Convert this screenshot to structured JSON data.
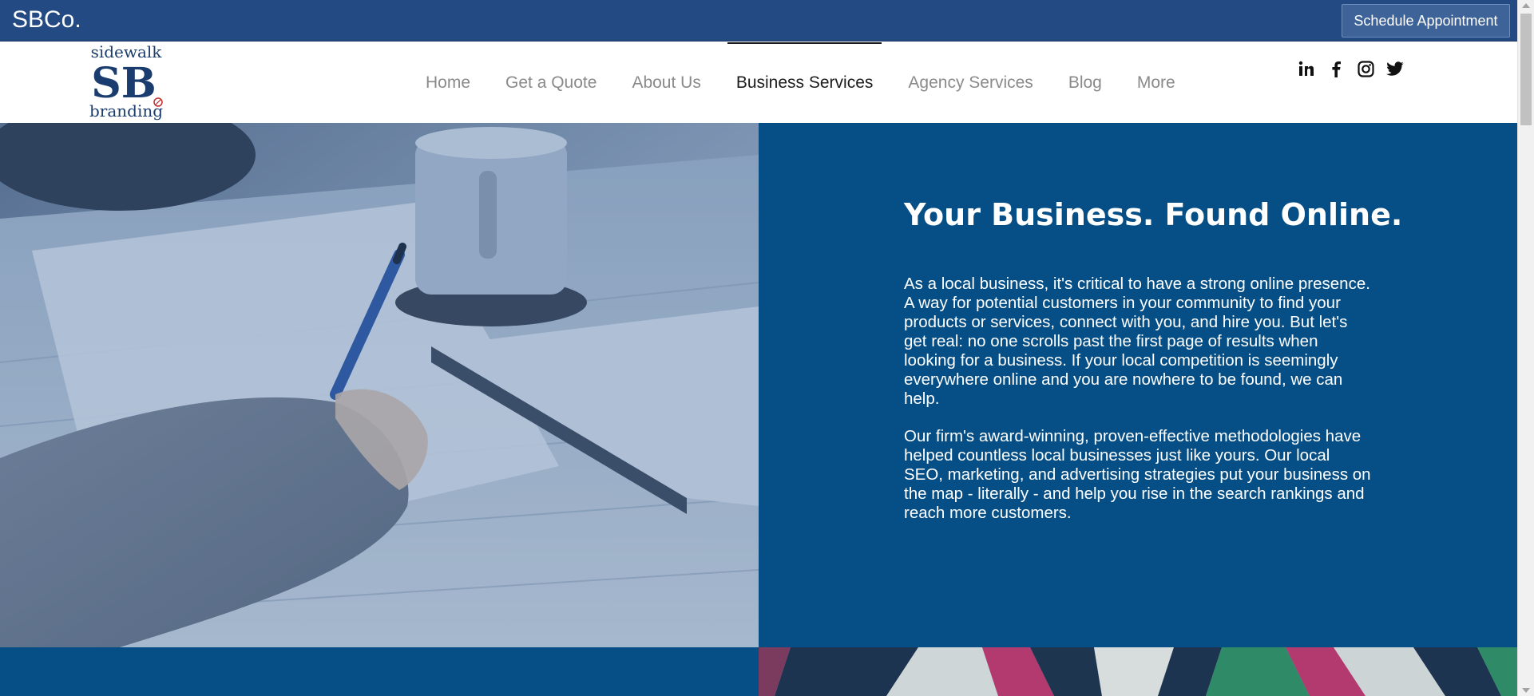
{
  "topbar": {
    "brand": "SBCo.",
    "schedule_label": "Schedule Appointment"
  },
  "logo": {
    "line1": "sidewalk",
    "initials": "SB",
    "line2": "branding"
  },
  "nav": {
    "items": [
      {
        "label": "Home",
        "active": false
      },
      {
        "label": "Get a Quote",
        "active": false
      },
      {
        "label": "About Us",
        "active": false
      },
      {
        "label": "Business Services",
        "active": true
      },
      {
        "label": "Agency Services",
        "active": false
      },
      {
        "label": "Blog",
        "active": false
      },
      {
        "label": "More",
        "active": false
      }
    ]
  },
  "social": {
    "icons": [
      "linkedin-icon",
      "facebook-icon",
      "instagram-icon",
      "twitter-icon"
    ]
  },
  "hero": {
    "title": "Your Business. Found Online.",
    "paragraph1": "As a local business, it's critical to have a strong online presence. A way for potential customers in your community to find your products or services, connect with you, and hire you. But let's get real: no one scrolls past the first page of results when looking for a business. If your local competition is seemingly everywhere online and you are nowhere to be found, we can help.",
    "paragraph2": "Our firm's award-winning, proven-effective methodologies have helped countless local businesses just like yours. Our local SEO, marketing, and advertising strategies put your business on the map - literally - and help you rise in the search rankings and reach more customers."
  },
  "colors": {
    "topbar": "#234a82",
    "panel": "#064f86",
    "nav_inactive": "#8a8a8a",
    "nav_active": "#1c1c1c"
  }
}
